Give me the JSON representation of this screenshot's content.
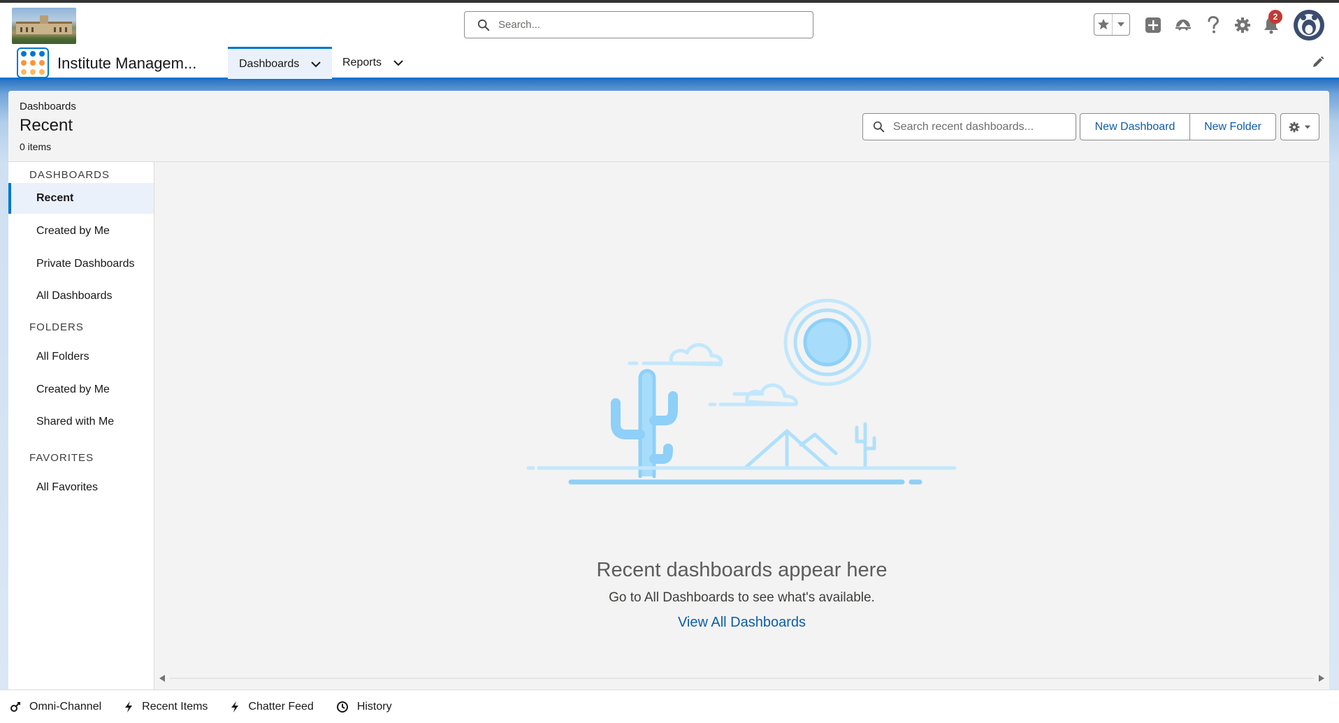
{
  "global_header": {
    "search_placeholder": "Search...",
    "notification_count": "2"
  },
  "nav": {
    "app_name": "Institute Managem...",
    "tabs": [
      {
        "label": "Dashboards"
      },
      {
        "label": "Reports"
      }
    ]
  },
  "page": {
    "breadcrumb": "Dashboards",
    "title": "Recent",
    "item_count": "0 items",
    "search_placeholder": "Search recent dashboards...",
    "new_dashboard_label": "New Dashboard",
    "new_folder_label": "New Folder"
  },
  "sidebar": {
    "sections": [
      {
        "heading": "DASHBOARDS",
        "items": [
          "Recent",
          "Created by Me",
          "Private Dashboards",
          "All Dashboards"
        ]
      },
      {
        "heading": "FOLDERS",
        "items": [
          "All Folders",
          "Created by Me",
          "Shared with Me"
        ]
      },
      {
        "heading": "FAVORITES",
        "items": [
          "All Favorites"
        ]
      }
    ],
    "active_item": "Recent"
  },
  "empty_state": {
    "title": "Recent dashboards appear here",
    "subtitle": "Go to All Dashboards to see what's available.",
    "link": "View All Dashboards"
  },
  "utility_bar": {
    "items": [
      "Omni-Channel",
      "Recent Items",
      "Chatter Feed",
      "History"
    ]
  },
  "colors": {
    "brand": "#0176d3",
    "link": "#0b5cab",
    "badge": "#c23934",
    "illustration": "#8ed0f7"
  },
  "icons": [
    "search-icon",
    "star-icon",
    "chevron-down-icon",
    "add-icon",
    "trailhead-icon",
    "help-icon",
    "gear-icon",
    "bell-icon",
    "avatar",
    "app-launcher-icon",
    "edit-pencil-icon",
    "omni-channel-icon",
    "lightning-icon",
    "clock-icon"
  ]
}
